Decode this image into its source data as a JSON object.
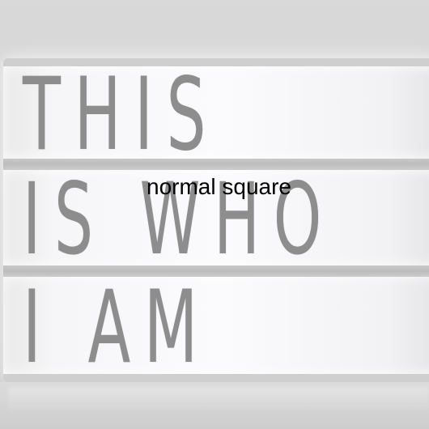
{
  "sign": {
    "line_1": "THIS",
    "line_2": "IS WHO",
    "line_3": "I AM"
  },
  "overlay": {
    "caption": "normal square"
  },
  "colors": {
    "letters": "#8d8d8d",
    "panel": "#fbfbfd",
    "background": "#d6d6d6",
    "caption": "#000000"
  }
}
